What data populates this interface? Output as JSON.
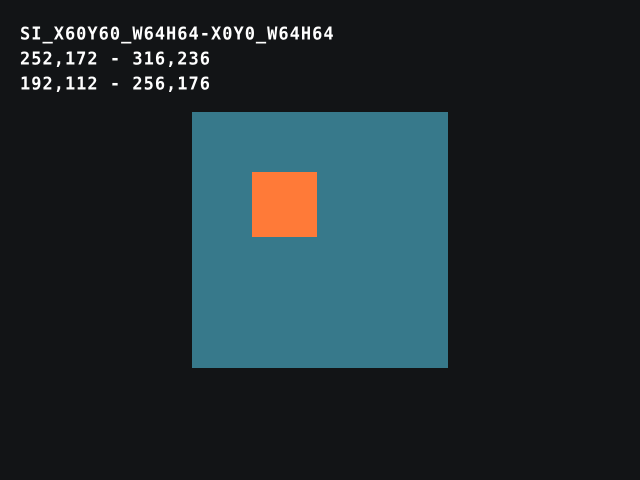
{
  "info": {
    "line1": "SI_X60Y60_W64H64-X0Y0_W64H64",
    "line2": "252,172 - 316,236",
    "line3": "192,112 - 256,176"
  },
  "colors": {
    "background": "#121416",
    "outer_rect": "#37798b",
    "inner_rect": "#ff7a38",
    "text": "#ffffff"
  }
}
